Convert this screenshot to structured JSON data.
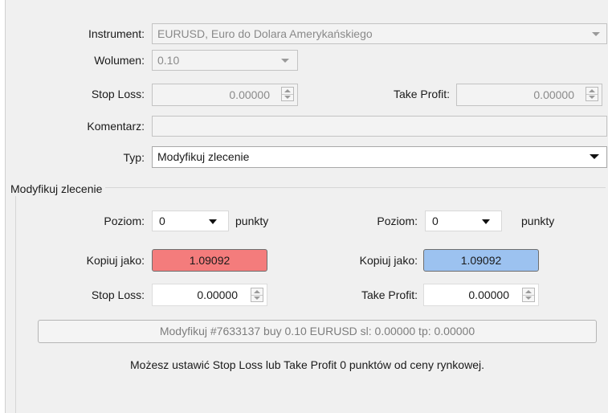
{
  "form": {
    "instrument_label": "Instrument:",
    "instrument_value": "EURUSD, Euro do Dolara Amerykańskiego",
    "volume_label": "Wolumen:",
    "volume_value": "0.10",
    "stop_loss_label": "Stop Loss:",
    "stop_loss_value": "0.00000",
    "take_profit_label": "Take Profit:",
    "take_profit_value": "0.00000",
    "comment_label": "Komentarz:",
    "comment_value": "",
    "type_label": "Typ:",
    "type_value": "Modyfikuj zlecenie"
  },
  "modify_group": {
    "title": "Modyfikuj zlecenie",
    "left": {
      "level_label": "Poziom:",
      "level_value": "0",
      "level_unit": "punkty",
      "copy_label": "Kopiuj jako:",
      "copy_value": "1.09092",
      "copy_color": "#f47c7c",
      "stop_loss_label": "Stop Loss:",
      "stop_loss_value": "0.00000"
    },
    "right": {
      "level_label": "Poziom:",
      "level_value": "0",
      "level_unit": "punkty",
      "copy_label": "Kopiuj jako:",
      "copy_value": "1.09092",
      "copy_color": "#9cc2f0",
      "take_profit_label": "Take Profit:",
      "take_profit_value": "0.00000"
    },
    "action_button": "Modyfikuj #7633137 buy 0.10 EURUSD sl: 0.00000 tp: 0.00000",
    "info_text": "Możesz ustawić Stop Loss lub Take Profit  0 punktów od ceny rynkowej."
  },
  "icons": {
    "dropdown": "chevron-down-icon",
    "spinner": "spinner-up-down-icon"
  }
}
